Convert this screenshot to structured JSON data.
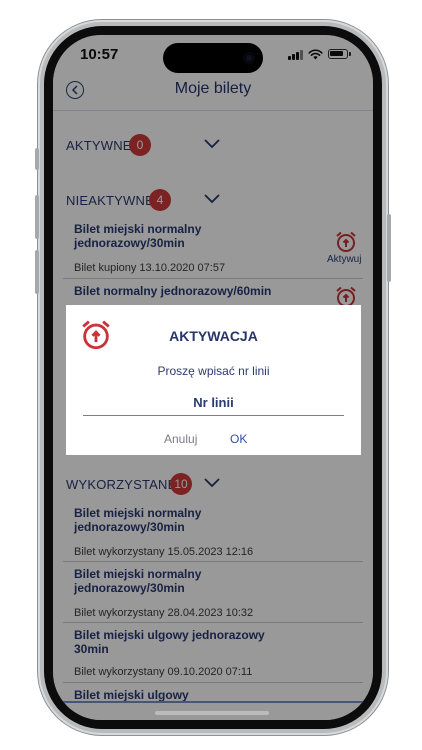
{
  "status_bar": {
    "time": "10:57"
  },
  "header": {
    "title": "Moje bilety"
  },
  "sections": {
    "active": {
      "label": "AKTYWNE",
      "count": "0"
    },
    "inactive": {
      "label": "NIEAKTYWNE",
      "count": "4",
      "tickets": [
        {
          "title": "Bilet miejski normalny jednorazowy/30min",
          "meta": "Bilet kupiony 13.10.2020 07:57",
          "action_label": "Aktywuj"
        },
        {
          "title": "Bilet normalny jednorazowy/60min"
        }
      ]
    },
    "used": {
      "label": "WYKORZYSTANE",
      "count": "10",
      "tickets": [
        {
          "title": "Bilet miejski normalny jednorazowy/30min",
          "meta": "Bilet wykorzystany 15.05.2023 12:16"
        },
        {
          "title": "Bilet miejski normalny jednorazowy/30min",
          "meta": "Bilet wykorzystany 28.04.2023 10:32"
        },
        {
          "title": "Bilet miejski ulgowy jednorazowy 30min",
          "meta": "Bilet wykorzystany 09.10.2020 07:11"
        },
        {
          "title": "Bilet miejski ulgowy"
        }
      ]
    }
  },
  "dialog": {
    "title": "AKTYWACJA",
    "message": "Proszę wpisać nr linii",
    "input_placeholder": "Nr linii",
    "cancel_label": "Anuluj",
    "ok_label": "OK"
  },
  "colors": {
    "accent_navy": "#27356b",
    "badge_red": "#d03a3a",
    "alarm_red": "#c8343a",
    "ok_blue": "#2f4fa6"
  },
  "icons": [
    "back-icon",
    "chevron-down-icon",
    "alarm-clock-icon",
    "signal-icon",
    "wifi-icon",
    "battery-icon"
  ]
}
